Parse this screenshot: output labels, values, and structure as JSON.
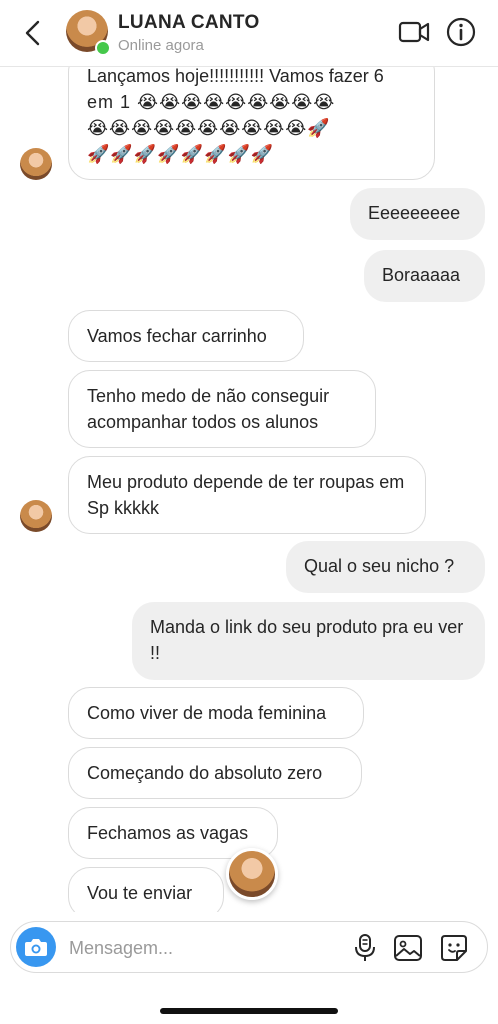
{
  "header": {
    "name": "LUANA CANTO",
    "status": "Online agora"
  },
  "messages": [
    {
      "side": "in",
      "text_line1": "Lançamos hoje!!!!!!!!!!! Vamos fazer 6",
      "text_line2": "em 1",
      "emoji_row2": "😭😭😭😭😭😭😭😭😭",
      "emoji_row3": "😭😭😭😭😭😭😭😭😭😭🚀",
      "emoji_row4": "🚀🚀🚀🚀🚀🚀🚀🚀"
    },
    {
      "side": "out",
      "text": "Eeeeeeeee"
    },
    {
      "side": "out",
      "text": "Boraaaaa"
    },
    {
      "side": "in",
      "text": "Vamos fechar carrinho"
    },
    {
      "side": "in",
      "text": "Tenho medo de não conseguir acompanhar todos os alunos"
    },
    {
      "side": "in",
      "text": "Meu produto depende de ter roupas em Sp kkkkk"
    },
    {
      "side": "out",
      "text": "Qual o seu nicho ?"
    },
    {
      "side": "out",
      "text": "Manda o link do seu produto pra eu ver !!"
    },
    {
      "side": "in",
      "text": "Como viver de moda feminina"
    },
    {
      "side": "in",
      "text": "Começando do absoluto zero"
    },
    {
      "side": "in",
      "text": "Fechamos as vagas"
    },
    {
      "side": "in",
      "text": "Vou te enviar"
    }
  ],
  "composer": {
    "placeholder": "Mensagem..."
  },
  "icons": {
    "back": "chevron-left-icon",
    "video": "video-camera-icon",
    "info": "info-icon",
    "camera": "camera-icon",
    "mic": "microphone-icon",
    "gallery": "image-gallery-icon",
    "sticker": "sticker-icon"
  },
  "colors": {
    "online": "#45c84b",
    "accent": "#3897f0",
    "outgoing_bubble": "#efefef",
    "incoming_border": "#dbdbdb"
  }
}
